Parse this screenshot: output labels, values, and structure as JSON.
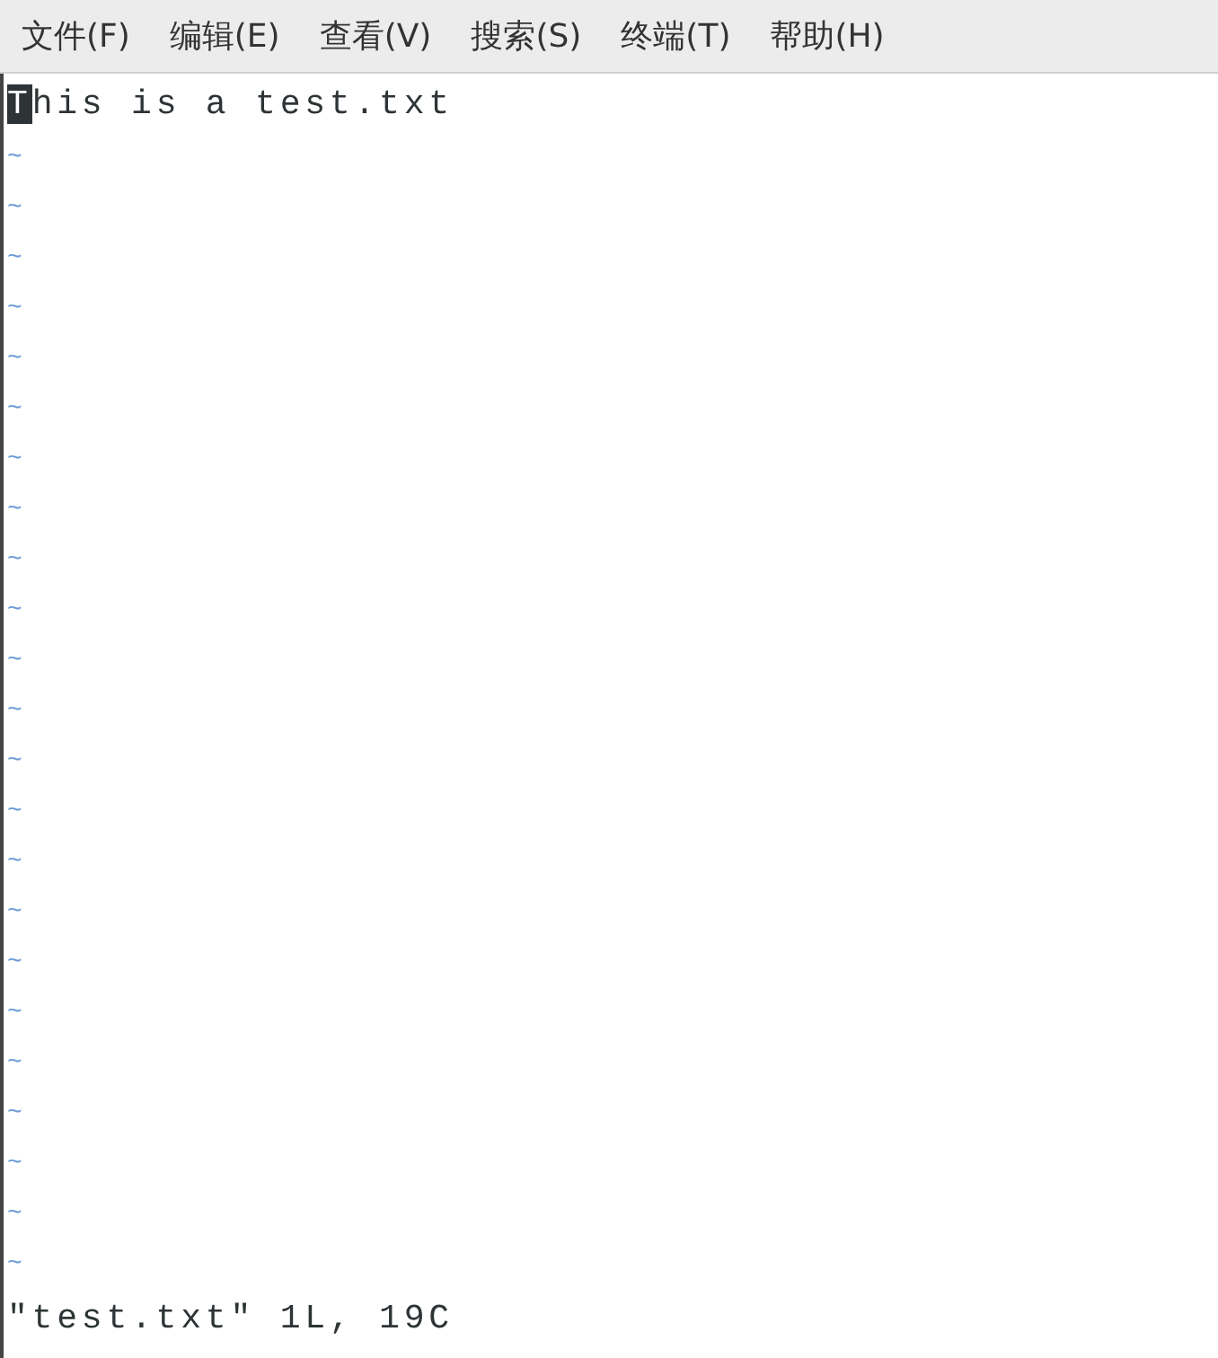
{
  "menu_bar": {
    "items": [
      "文件(F)",
      "编辑(E)",
      "查看(V)",
      "搜索(S)",
      "终端(T)",
      "帮助(H)"
    ]
  },
  "editor": {
    "lines": [
      {
        "text": "This is a test.txt",
        "cursor": true
      }
    ],
    "empty_line_markers": [
      "~",
      "~",
      "~",
      "~",
      "~",
      "~",
      "~",
      "~",
      "~",
      "~",
      "~",
      "~",
      "~",
      "~",
      "~",
      "~",
      "~",
      "~",
      "~",
      "~",
      "~",
      "~",
      "~"
    ]
  },
  "status_line": "\"test.txt\" 1L, 19C"
}
